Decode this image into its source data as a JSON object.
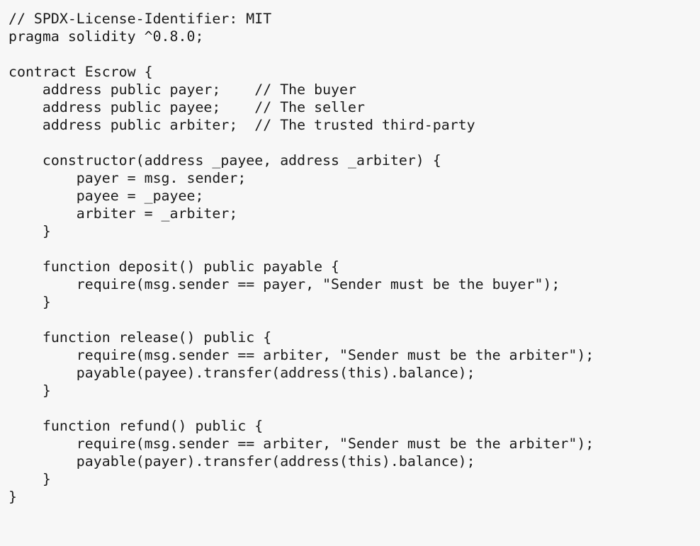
{
  "document": {
    "kind": "source-code-listing",
    "language": "Solidity",
    "contract_name": "Escrow",
    "license": "MIT",
    "pragma": "^0.8.0",
    "background_color": "#f7f7f7",
    "text_color": "#1a1a1a",
    "font_size_px": 20,
    "line_height_px": 25,
    "indent_spaces": 4,
    "syntax_highlighting": false
  },
  "code": {
    "lines": [
      "// SPDX-License-Identifier: MIT",
      "pragma solidity ^0.8.0;",
      "",
      "contract Escrow {",
      "    address public payer;    // The buyer",
      "    address public payee;    // The seller",
      "    address public arbiter;  // The trusted third-party",
      "",
      "    constructor(address _payee, address _arbiter) {",
      "        payer = msg. sender;",
      "        payee = _payee;",
      "        arbiter = _arbiter;",
      "    }",
      "",
      "    function deposit() public payable {",
      "        require(msg.sender == payer, \"Sender must be the buyer\");",
      "    }",
      "",
      "    function release() public {",
      "        require(msg.sender == arbiter, \"Sender must be the arbiter\");",
      "        payable(payee).transfer(address(this).balance);",
      "    }",
      "",
      "    function refund() public {",
      "        require(msg.sender == arbiter, \"Sender must be the arbiter\");",
      "        payable(payer).transfer(address(this).balance);",
      "    }",
      "}"
    ]
  }
}
